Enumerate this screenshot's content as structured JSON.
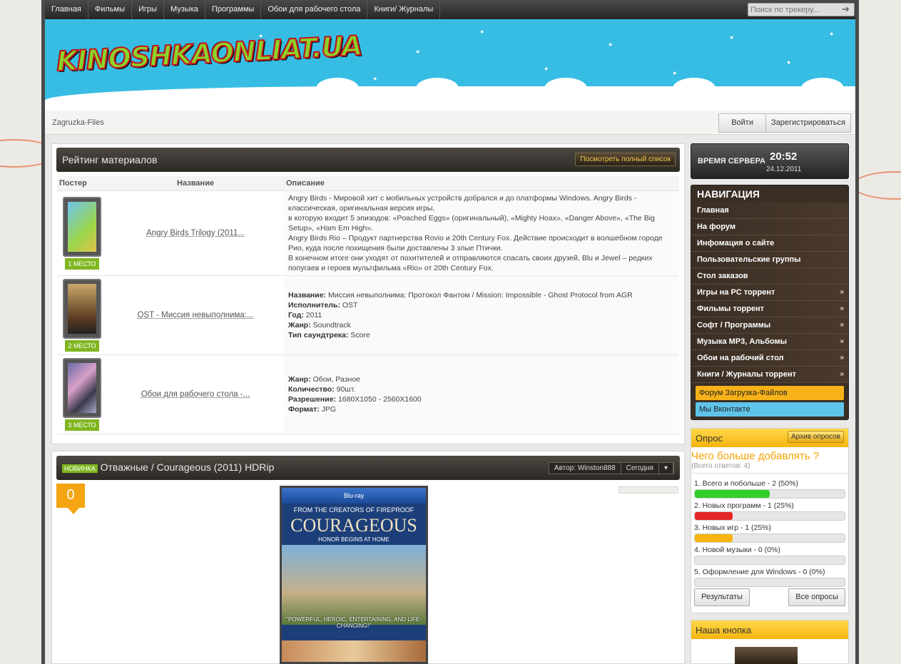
{
  "topnav": {
    "items": [
      "Главная",
      "Фильмы",
      "Игры",
      "Музыка",
      "Программы",
      "Обои для рабочего стола",
      "Книги/ Журналы"
    ],
    "search_placeholder": "Поиск по трекеру..."
  },
  "header": {
    "logo": "KINOSHKAONLIAT.UA"
  },
  "crumbbar": {
    "breadcrumb": "Zagruzka-Files",
    "login": "Войти",
    "register": "Зарегистрироваться"
  },
  "rating": {
    "title": "Рейтинг материалов",
    "full_list": "Посмотреть полный список",
    "columns": [
      "Постер",
      "Название",
      "Описание"
    ],
    "rows": [
      {
        "place": "1 МЕСТО",
        "name": "Angry Birds Trilogy (2011...",
        "desc_lines": [
          "Angry Birds - Мировой хит с мобильных устройств добрался и до платформы Windows. Angry Birds - классическая, оригинальная версия игры,",
          "в которую входит 5 эпизодов: «Poached Eggs» (оригинальный), «Mighty Hoax», «Danger Above», «The Big Setup», «Ham Em High».",
          "Angry Birds Rio – Продукт партнерства Rovio и 20th Century Fox. Действие происходит в волшебном городе Рио, куда после похищения были доставлены 3 злые Птички.",
          "В конечном итоге они уходят от похитителей и отправляются спасать своих друзей, Blu и Jewel – редких попугаев и героев мультфильма «Rio» от 20th Century Fox."
        ]
      },
      {
        "place": "2 МЕСТО",
        "name": "OST - Миссия невыполнима:...",
        "fields": [
          {
            "k": "Название:",
            "v": " Миссия невыполнима: Протокол Фантом / Mission: Impossible - Ghost Protocol from AGR"
          },
          {
            "k": "Исполнитель:",
            "v": " OST"
          },
          {
            "k": "Год:",
            "v": " 2011"
          },
          {
            "k": "Жанр:",
            "v": " Soundtrack"
          },
          {
            "k": "Тип саундтрека:",
            "v": " Score"
          }
        ]
      },
      {
        "place": "3 МЕСТО",
        "name": "Обои для рабочего стола -...",
        "fields": [
          {
            "k": "Жанр:",
            "v": " Обои, Разное"
          },
          {
            "k": "Количество:",
            "v": " 90шт."
          },
          {
            "k": "Разрешение:",
            "v": " 1680X1050 - 2560X1600"
          },
          {
            "k": "Формат:",
            "v": " JPG"
          }
        ]
      }
    ]
  },
  "news": {
    "badge": "НОВИНКА",
    "title": "Отважные / Courageous (2011) HDRip",
    "author": "Автор: Winston888",
    "date": "Сегодня",
    "comments": "0",
    "cover": {
      "top": "FROM THE CREATORS OF FIREPROOF",
      "title": "COURAGEOUS",
      "tag": "HONOR BEGINS AT HOME",
      "quote": "\"POWERFUL, HEROIC, ENTERTAINING, AND LIFE-CHANGING!\""
    }
  },
  "sidebar": {
    "clock": {
      "label": "ВРЕМЯ СЕРВЕРА",
      "time": "20:52",
      "date": "24.12.2011"
    },
    "nav_title": "НАВИГАЦИЯ",
    "nav": [
      {
        "label": "Главная",
        "sub": false
      },
      {
        "label": "На форум",
        "sub": false
      },
      {
        "label": "Инфомация о сайте",
        "sub": false
      },
      {
        "label": "Пользовательские группы",
        "sub": false
      },
      {
        "label": "Стол заказов",
        "sub": false
      },
      {
        "label": "Игры на PC торрент",
        "sub": true
      },
      {
        "label": "Фильмы торрент",
        "sub": true
      },
      {
        "label": "Софт / Программы",
        "sub": true
      },
      {
        "label": "Музыка MP3, Альбомы",
        "sub": true
      },
      {
        "label": "Обои на рабочий стол",
        "sub": true
      },
      {
        "label": "Книги / Журналы торрент",
        "sub": true
      }
    ],
    "pills": [
      {
        "label": "Форум Загрузка-Файлов",
        "color": "#f7b21a"
      },
      {
        "label": "Мы Вконтакте",
        "color": "#5fc4ea"
      }
    ],
    "poll": {
      "title": "Опрос",
      "archive": "Архив опросов",
      "question": "Чего больше добавлять ?",
      "total": "(Всего ответов: 4)",
      "answers": [
        {
          "label": "1. Всего и побольше - 2 (50%)",
          "pct": 50,
          "color": "#2fd12a"
        },
        {
          "label": "2. Новых программ - 1 (25%)",
          "pct": 25,
          "color": "#e52626"
        },
        {
          "label": "3. Новых игр - 1 (25%)",
          "pct": 25,
          "color": "#f5b40f"
        },
        {
          "label": "4. Новой музыки - 0 (0%)",
          "pct": 0,
          "color": "#999999"
        },
        {
          "label": "5. Оформление для Windows - 0 (0%)",
          "pct": 0,
          "color": "#999999"
        }
      ],
      "results": "Результаты",
      "all": "Все опросы"
    },
    "ours_title": "Наша кнопка"
  }
}
